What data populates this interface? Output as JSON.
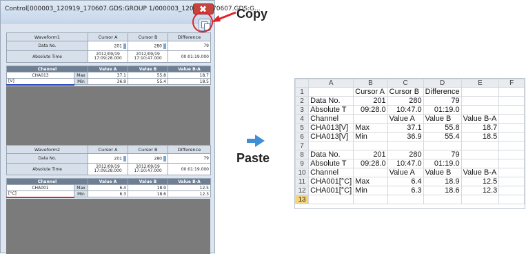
{
  "window": {
    "title": "Control[000003_120919_170607.GDS:GROUP 1/000003_120919_170607.GDS:G..."
  },
  "annotations": {
    "copy": "Copy",
    "paste": "Paste"
  },
  "panel1": {
    "header": [
      "Waveform1",
      "Cursor A",
      "Cursor B",
      "Difference"
    ],
    "data_no": {
      "label": "Data No.",
      "a": "201",
      "b": "280",
      "diff": "79"
    },
    "abs_time": {
      "label": "Absolute Time",
      "a_date": "2012/09/19",
      "a_time": "17:09:28.000",
      "b_date": "2012/09/19",
      "b_time": "17:10:47.000",
      "diff": "00:01:19.000"
    },
    "ch_header": [
      "Channel",
      "Value A",
      "Value B",
      "Value B-A"
    ],
    "channel": "CHA013",
    "unit": "[V]",
    "max": {
      "label": "Max",
      "a": "37.1",
      "b": "55.8",
      "diff": "18.7"
    },
    "min": {
      "label": "Min",
      "a": "36.9",
      "b": "55.4",
      "diff": "18.5"
    },
    "line_color": "#1f3fbf"
  },
  "panel2": {
    "header": [
      "Waveform2",
      "Cursor A",
      "Cursor B",
      "Difference"
    ],
    "data_no": {
      "label": "Data No.",
      "a": "201",
      "b": "280",
      "diff": "79"
    },
    "abs_time": {
      "label": "Absolute Time",
      "a_date": "2012/09/19",
      "a_time": "17:09:28.000",
      "b_date": "2012/09/19",
      "b_time": "17:10:47.000",
      "diff": "00:01:19.000"
    },
    "ch_header": [
      "Channel",
      "Value A",
      "Value B",
      "Value B-A"
    ],
    "channel": "CHA001",
    "unit": "[°C]",
    "max": {
      "label": "Max",
      "a": "6.4",
      "b": "18.9",
      "diff": "12.5"
    },
    "min": {
      "label": "Min",
      "a": "6.3",
      "b": "18.6",
      "diff": "12.3"
    },
    "line_color": "#d92b2b"
  },
  "spreadsheet": {
    "columns": [
      "A",
      "B",
      "C",
      "D",
      "E",
      "F"
    ],
    "selected_row": "13",
    "rows": [
      [
        "1",
        "",
        "Cursor A",
        "Cursor B",
        "Difference",
        "",
        ""
      ],
      [
        "2",
        "Data No.",
        "201",
        "280",
        "79",
        "",
        ""
      ],
      [
        "3",
        "Absolute T",
        "09:28.0",
        "10:47.0",
        "01:19.0",
        "",
        ""
      ],
      [
        "4",
        "Channel",
        "",
        "Value A",
        "Value B",
        "Value B-A",
        ""
      ],
      [
        "5",
        "CHA013[V]",
        "Max",
        "37.1",
        "55.8",
        "18.7",
        ""
      ],
      [
        "6",
        "CHA013[V]",
        "Min",
        "36.9",
        "55.4",
        "18.5",
        ""
      ],
      [
        "7",
        "",
        "",
        "",
        "",
        "",
        ""
      ],
      [
        "8",
        "Data No.",
        "201",
        "280",
        "79",
        "",
        ""
      ],
      [
        "9",
        "Absolute T",
        "09:28.0",
        "10:47.0",
        "01:19.0",
        "",
        ""
      ],
      [
        "10",
        "Channel",
        "",
        "Value A",
        "Value B",
        "Value B-A",
        ""
      ],
      [
        "11",
        "CHA001[°C]",
        "Max",
        "6.4",
        "18.9",
        "12.5",
        ""
      ],
      [
        "12",
        "CHA001[°C]",
        "Min",
        "6.3",
        "18.6",
        "12.3",
        ""
      ],
      [
        "13",
        "",
        "",
        "",
        "",
        "",
        ""
      ]
    ]
  },
  "colors": {
    "accent_red": "#e0232a",
    "arrow_blue": "#3e8fd6",
    "selected_row": "#f6d47a"
  }
}
